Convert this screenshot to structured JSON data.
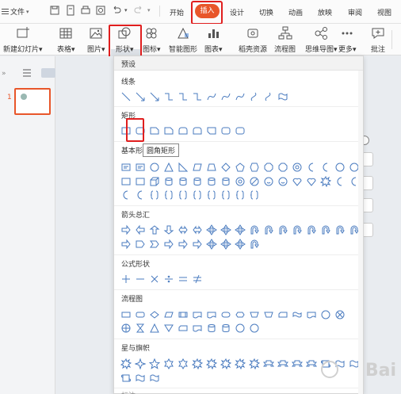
{
  "menubar": {
    "file_label": "文件",
    "tabs": [
      "开始",
      "插入",
      "设计",
      "切换",
      "动画",
      "放映",
      "审阅",
      "视图"
    ],
    "active_tab": "插入",
    "accent": "#e8562a",
    "highlight": "#e01e1e"
  },
  "ribbon": {
    "new_slide": "新建幻灯片",
    "table": "表格",
    "picture": "图片",
    "shape": "形状",
    "icon": "图标",
    "smartart": "智能图形",
    "chart": "图表",
    "docer": "稻壳资源",
    "flowchart": "流程图",
    "mindmap": "思维导图",
    "more": "更多",
    "comment": "批注"
  },
  "slides": {
    "number": "1"
  },
  "shapes_panel": {
    "header": "预设",
    "tooltip": "圆角矩形",
    "categories": {
      "lines": "线条",
      "rect": "矩形",
      "basic": "基本形状",
      "arrows": "箭头总汇",
      "formula": "公式形状",
      "flow": "流程图",
      "stars": "星与旗帜",
      "callouts": "标注"
    }
  }
}
